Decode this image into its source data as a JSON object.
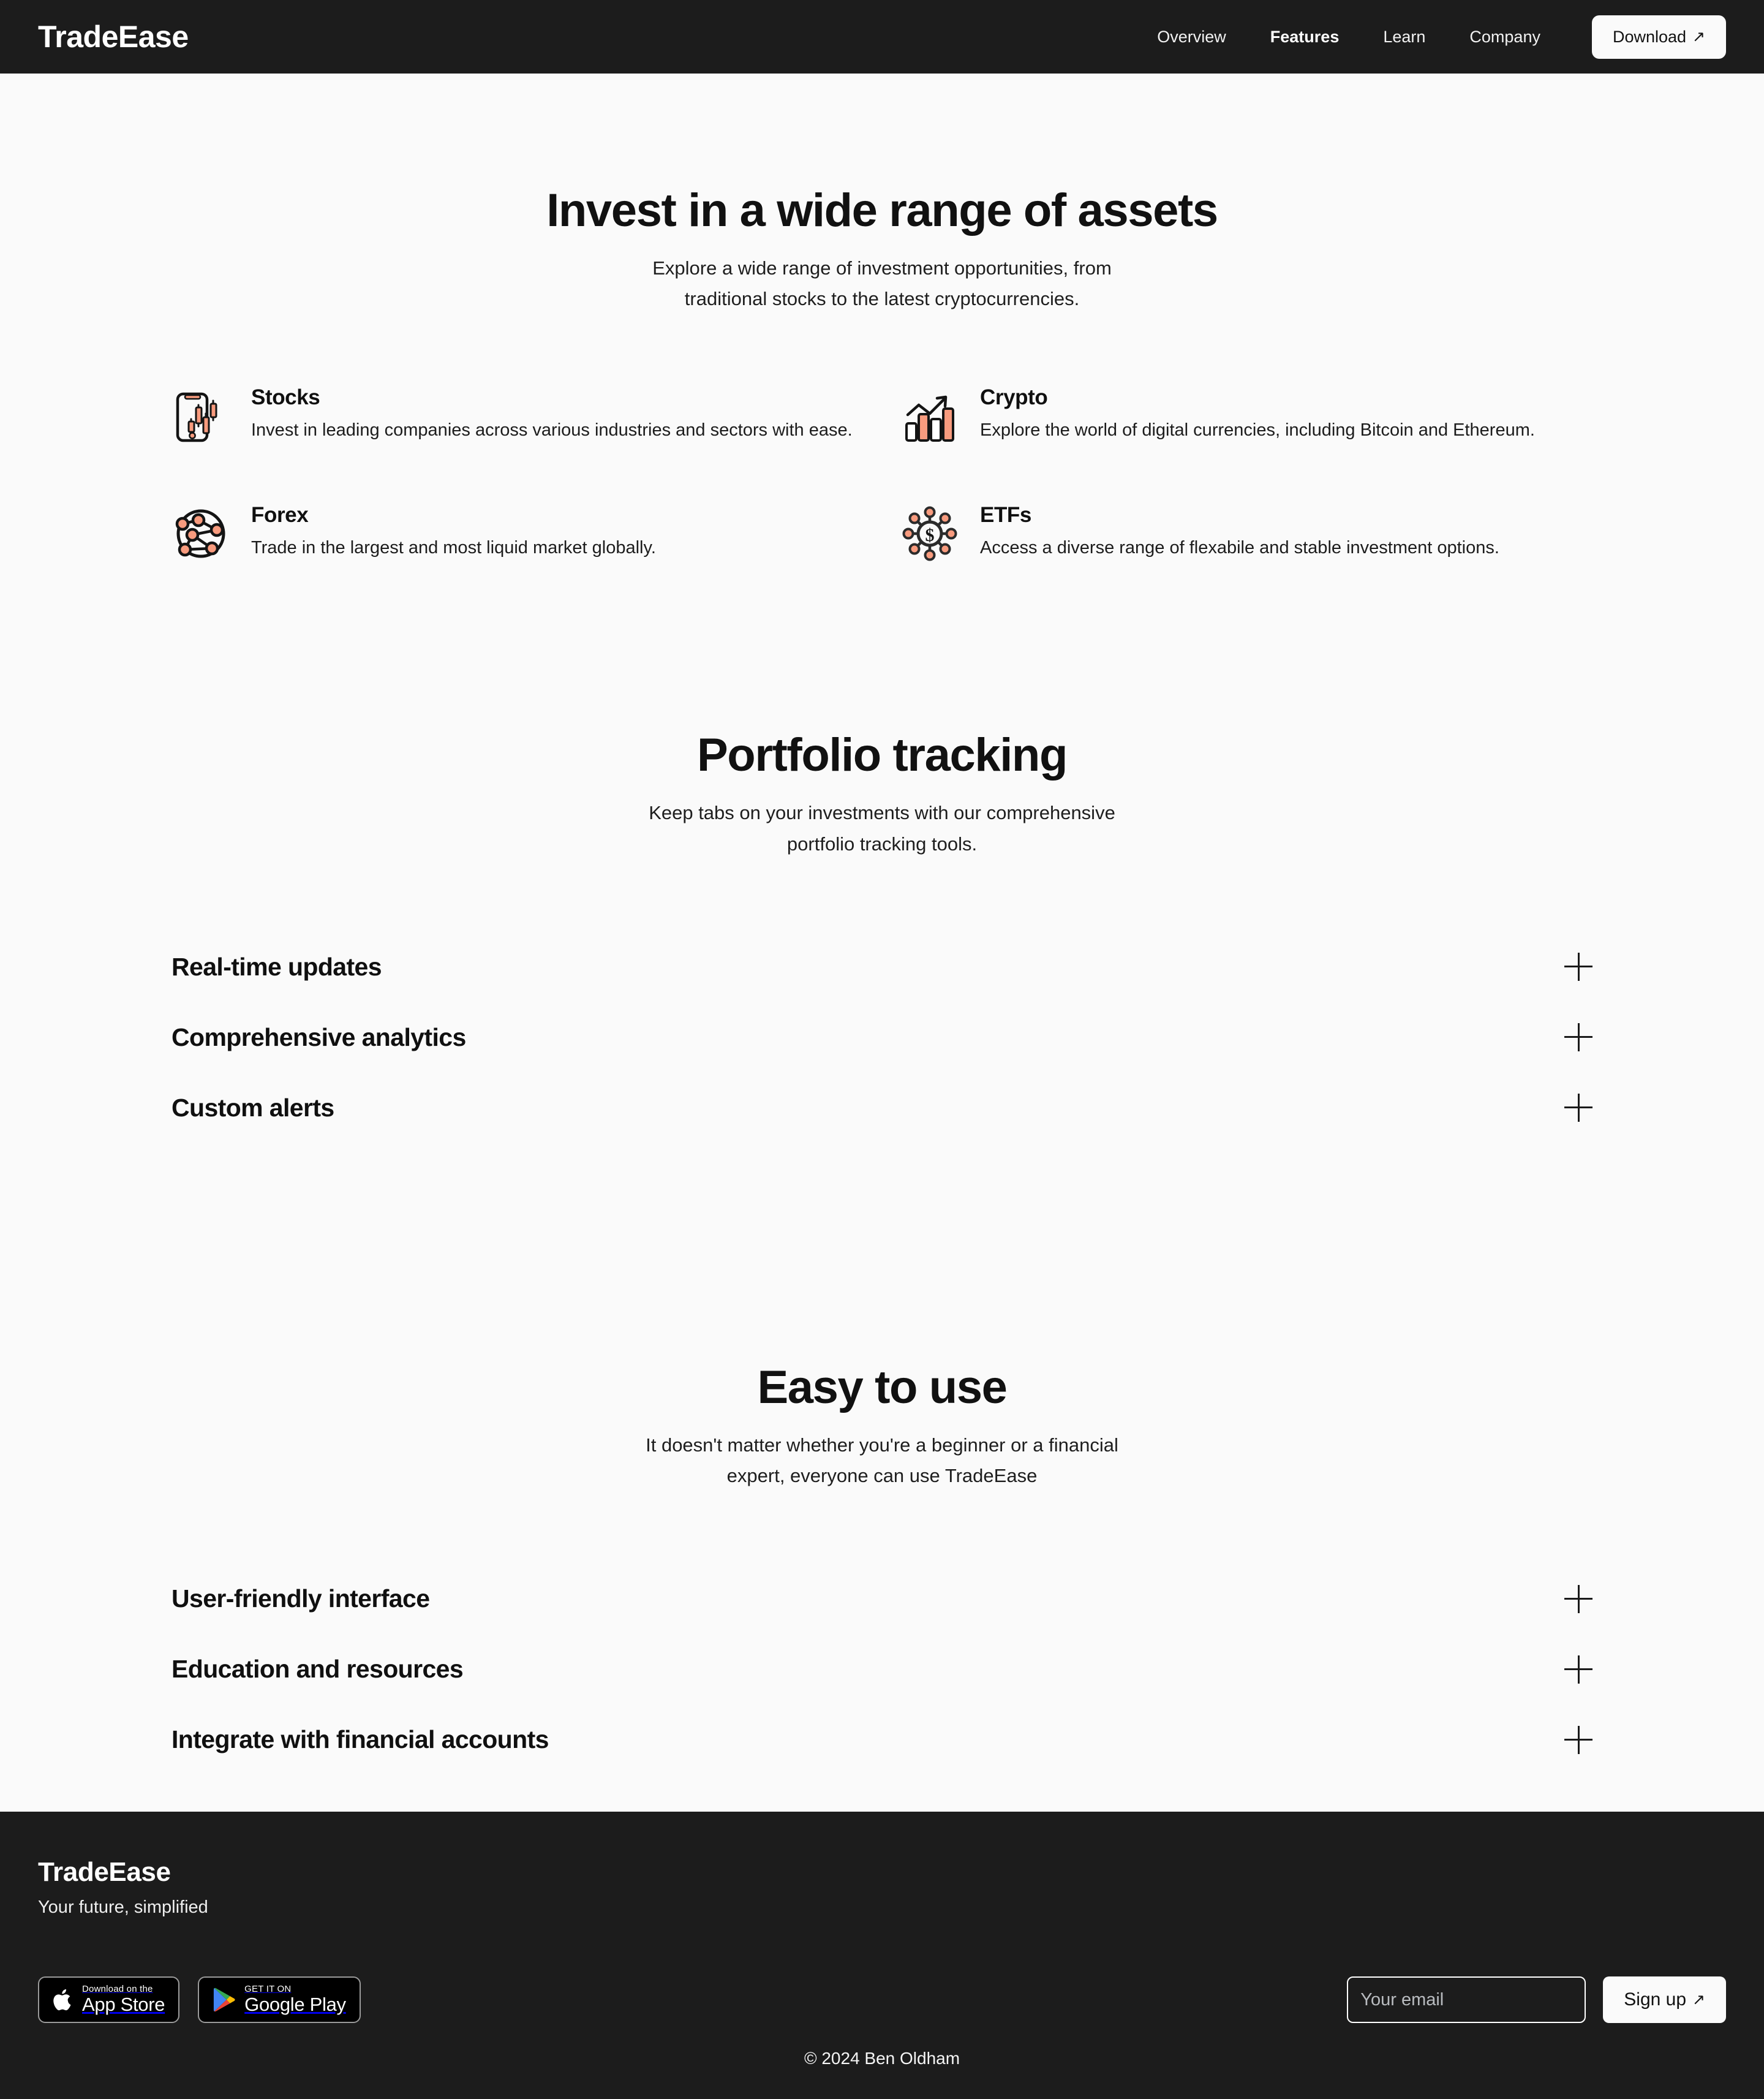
{
  "header": {
    "brand": "TradeEase",
    "nav": [
      {
        "label": "Overview",
        "active": false
      },
      {
        "label": "Features",
        "active": true
      },
      {
        "label": "Learn",
        "active": false
      },
      {
        "label": "Company",
        "active": false
      }
    ],
    "download_label": "Download",
    "download_arrow": "↗"
  },
  "assets_section": {
    "title": "Invest in a wide range of assets",
    "subtitle_line1": "Explore a wide range of investment opportunities, from",
    "subtitle_line2": "traditional stocks to the latest cryptocurrencies.",
    "items": [
      {
        "icon": "phone-candlestick-chart-icon",
        "title": "Stocks",
        "desc": "Invest in leading companies across various industries and sectors with ease."
      },
      {
        "icon": "bar-chart-growth-arrow-icon",
        "title": "Crypto",
        "desc": "Explore the world of digital currencies, including Bitcoin and Ethereum."
      },
      {
        "icon": "globe-network-nodes-icon",
        "title": "Forex",
        "desc": "Trade in the largest and most liquid market globally."
      },
      {
        "icon": "dollar-network-hub-icon",
        "title": "ETFs",
        "desc": "Access a diverse range of flexabile and stable investment options."
      }
    ]
  },
  "portfolio_section": {
    "title": "Portfolio tracking",
    "subtitle_line1": "Keep tabs on your investments with our comprehensive",
    "subtitle_line2": "portfolio tracking tools.",
    "accordion": [
      {
        "label": "Real-time updates",
        "icon": "plus-icon"
      },
      {
        "label": "Comprehensive analytics",
        "icon": "plus-icon"
      },
      {
        "label": "Custom alerts",
        "icon": "plus-icon"
      }
    ]
  },
  "easy_section": {
    "title": "Easy to use",
    "subtitle_line1": "It doesn't matter whether you're a beginner or a financial",
    "subtitle_line2": "expert, everyone can use TradeEase",
    "accordion": [
      {
        "label": "User-friendly interface",
        "icon": "plus-icon"
      },
      {
        "label": "Education and resources",
        "icon": "plus-icon"
      },
      {
        "label": "Integrate with financial accounts",
        "icon": "plus-icon"
      }
    ]
  },
  "footer": {
    "brand": "TradeEase",
    "tagline": "Your future, simplified",
    "app_store": {
      "small": "Download on the",
      "big": "App Store",
      "icon": "apple-logo-icon"
    },
    "google_play": {
      "small": "GET IT ON",
      "big": "Google Play",
      "icon": "google-play-logo-icon"
    },
    "email_placeholder": "Your email",
    "email_value": "",
    "signup_label": "Sign up",
    "signup_arrow": "↗",
    "copyright": "© 2024 Ben Oldham"
  },
  "colors": {
    "accent_salmon": "#f89b7e",
    "dark": "#1c1c1c",
    "page_bg": "#fafafa",
    "text": "#111111"
  }
}
